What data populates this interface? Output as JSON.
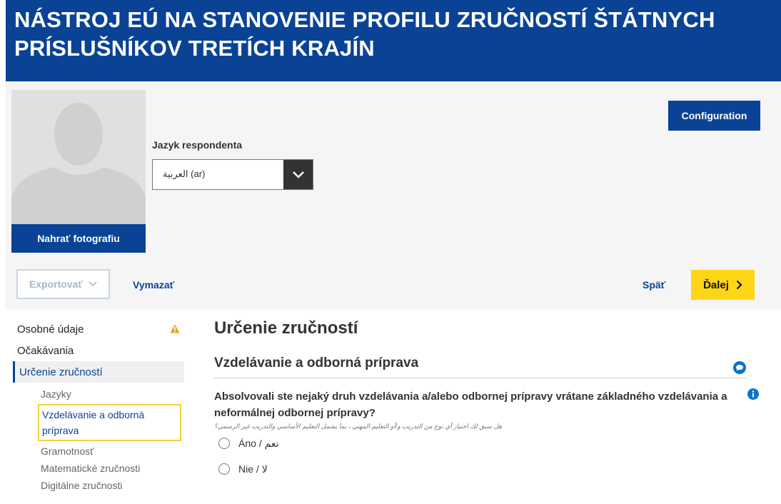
{
  "header": {
    "title": "NÁSTROJ EÚ NA STANOVENIE PROFILU ZRUČNOSTÍ ŠTÁTNYCH PRÍSLUŠNÍKOV TRETÍCH KRAJÍN"
  },
  "profile": {
    "upload_photo_label": "Nahrať fotografiu",
    "language_label": "Jazyk respondenta",
    "language_value": "العربية (ar)",
    "configuration_label": "Configuration"
  },
  "toolbar": {
    "export_label": "Exportovať",
    "clear_label": "Vymazať",
    "back_label": "Späť",
    "next_label": "Ďalej"
  },
  "sidebar": {
    "items": [
      {
        "label": "Osobné údaje"
      },
      {
        "label": "Očakávania"
      },
      {
        "label": "Určenie zručností"
      }
    ],
    "subitems": [
      {
        "label": "Jazyky"
      },
      {
        "label": "Vzdelávanie a odborná príprava"
      },
      {
        "label": "Gramotnosť"
      },
      {
        "label": "Matematické zručnosti"
      },
      {
        "label": "Digitálne zručnosti"
      }
    ]
  },
  "main": {
    "page_title": "Určenie zručností",
    "section_title": "Vzdelávanie a odborná príprava",
    "question": "Absolvovali ste nejaký druh vzdelávania a/alebo odbornej prípravy vrátane základného vzdelávania a neformálnej odbornej prípravy?",
    "question_translation": "هل سبق لك اجتياز أي نوع من التدريب و/أو التعليم المهني ، بما يشمل التعليم الأساسي والتدريب غير الرسمي؟",
    "options": [
      {
        "label": "Áno / نعم"
      },
      {
        "label": "Nie / لا"
      }
    ]
  },
  "colors": {
    "brand_blue": "#0a4396",
    "accent_yellow": "#ffd617",
    "warning_orange": "#f29d2a",
    "highlight_border": "#f5d13a"
  }
}
